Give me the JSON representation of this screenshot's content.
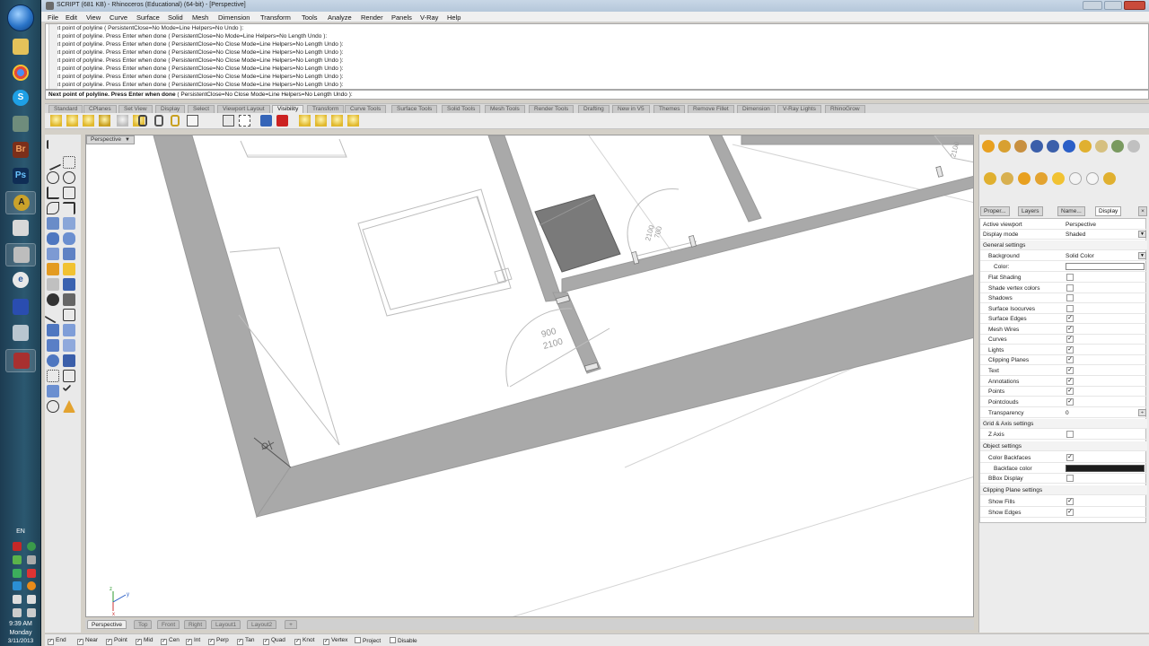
{
  "window": {
    "title": "SCRIPT (681 KB) - Rhinoceros (Educational) (64-bit) - [Perspective]"
  },
  "menu": [
    "File",
    "Edit",
    "View",
    "Curve",
    "Surface",
    "Solid",
    "Mesh",
    "Dimension",
    "Transform",
    "Tools",
    "Analyze",
    "Render",
    "Panels",
    "V-Ray",
    "Help"
  ],
  "command_history": [
    "Next point of polyline ( PersistentClose=No  Mode=Line  Helpers=No  Undo ):",
    "Next point of polyline. Press Enter when done ( PersistentClose=No  Mode=Line  Helpers=No  Length  Undo ):",
    "Next point of polyline. Press Enter when done ( PersistentClose=No  Close  Mode=Line  Helpers=No  Length  Undo ):",
    "Next point of polyline. Press Enter when done ( PersistentClose=No  Close  Mode=Line  Helpers=No  Length  Undo ):",
    "Next point of polyline. Press Enter when done ( PersistentClose=No  Close  Mode=Line  Helpers=No  Length  Undo ):",
    "Next point of polyline. Press Enter when done ( PersistentClose=No  Close  Mode=Line  Helpers=No  Length  Undo ):",
    "Next point of polyline. Press Enter when done ( PersistentClose=No  Close  Mode=Line  Helpers=No  Length  Undo ):",
    "Next point of polyline. Press Enter when done ( PersistentClose=No  Close  Mode=Line  Helpers=No  Length  Undo ):"
  ],
  "command_prompt": {
    "bold": "Next point of polyline. Press Enter when done",
    "options": "( PersistentClose=No  Close  Mode=Line  Helpers=No  Length  Undo ):"
  },
  "toolbar_tabs": [
    "Standard",
    "CPlanes",
    "Set View",
    "Display",
    "Select",
    "Viewport Layout",
    "Visibility",
    "Transform",
    "Curve Tools",
    "Surface Tools",
    "Solid Tools",
    "Mesh Tools",
    "Render Tools",
    "Drafting",
    "New in V5",
    "Themes",
    "Remove Fillet",
    "Dimension",
    "V-Ray Lights",
    "RhinoGrow"
  ],
  "active_toolbar_tab": "Visibility",
  "viewport": {
    "title": "Perspective",
    "dim_labels": [
      {
        "top": "900",
        "bottom": "2100"
      },
      {
        "top": "700",
        "bottom": "2100"
      },
      {
        "top": "2100",
        "bottom": ""
      }
    ],
    "axis_labels": {
      "x": "x",
      "y": "y",
      "z": "z"
    }
  },
  "viewport_tabs": [
    "Perspective",
    "Top",
    "Front",
    "Right",
    "Layout1",
    "Layout2"
  ],
  "active_viewport_tab": "Perspective",
  "osnaps": [
    {
      "label": "End",
      "checked": true
    },
    {
      "label": "Near",
      "checked": true
    },
    {
      "label": "Point",
      "checked": true
    },
    {
      "label": "Mid",
      "checked": true
    },
    {
      "label": "Cen",
      "checked": true
    },
    {
      "label": "Int",
      "checked": true
    },
    {
      "label": "Perp",
      "checked": true
    },
    {
      "label": "Tan",
      "checked": true
    },
    {
      "label": "Quad",
      "checked": true
    },
    {
      "label": "Knot",
      "checked": true
    },
    {
      "label": "Vertex",
      "checked": true
    },
    {
      "label": "Project",
      "checked": false
    },
    {
      "label": "Disable",
      "checked": false
    }
  ],
  "panel_tabs": [
    "Proper...",
    "Layers",
    "Name...",
    "Display"
  ],
  "active_panel_tab": "Display",
  "display_props": {
    "active_viewport_label": "Active viewport",
    "active_viewport_value": "Perspective",
    "display_mode_label": "Display mode",
    "display_mode_value": "Shaded",
    "general_settings": "General settings",
    "background_label": "Background",
    "background_value": "Solid Color",
    "color_label": "Color:",
    "rows": [
      {
        "label": "Flat Shading",
        "checked": false
      },
      {
        "label": "Shade vertex colors",
        "checked": false
      },
      {
        "label": "Shadows",
        "checked": false
      },
      {
        "label": "Surface Isocurves",
        "checked": false
      },
      {
        "label": "Surface Edges",
        "checked": true
      },
      {
        "label": "Mesh Wires",
        "checked": true
      },
      {
        "label": "Curves",
        "checked": true
      },
      {
        "label": "Lights",
        "checked": true
      },
      {
        "label": "Clipping Planes",
        "checked": true
      },
      {
        "label": "Text",
        "checked": true
      },
      {
        "label": "Annotations",
        "checked": true
      },
      {
        "label": "Points",
        "checked": true
      },
      {
        "label": "Pointclouds",
        "checked": true
      }
    ],
    "transparency_label": "Transparency",
    "transparency_value": "0",
    "grid_axis_settings": "Grid & Axis settings",
    "z_axis_label": "Z Axis",
    "object_settings": "Object settings",
    "color_backfaces_label": "Color Backfaces",
    "backface_color_label": "Backface color",
    "bbox_display_label": "BBox Display",
    "clipping_plane_settings": "Clipping Plane settings",
    "show_fills_label": "Show Fills",
    "show_edges_label": "Show Edges"
  },
  "system_tray": {
    "language": "EN",
    "time": "9:39 AM",
    "day": "Monday",
    "date": "3/11/2013"
  }
}
